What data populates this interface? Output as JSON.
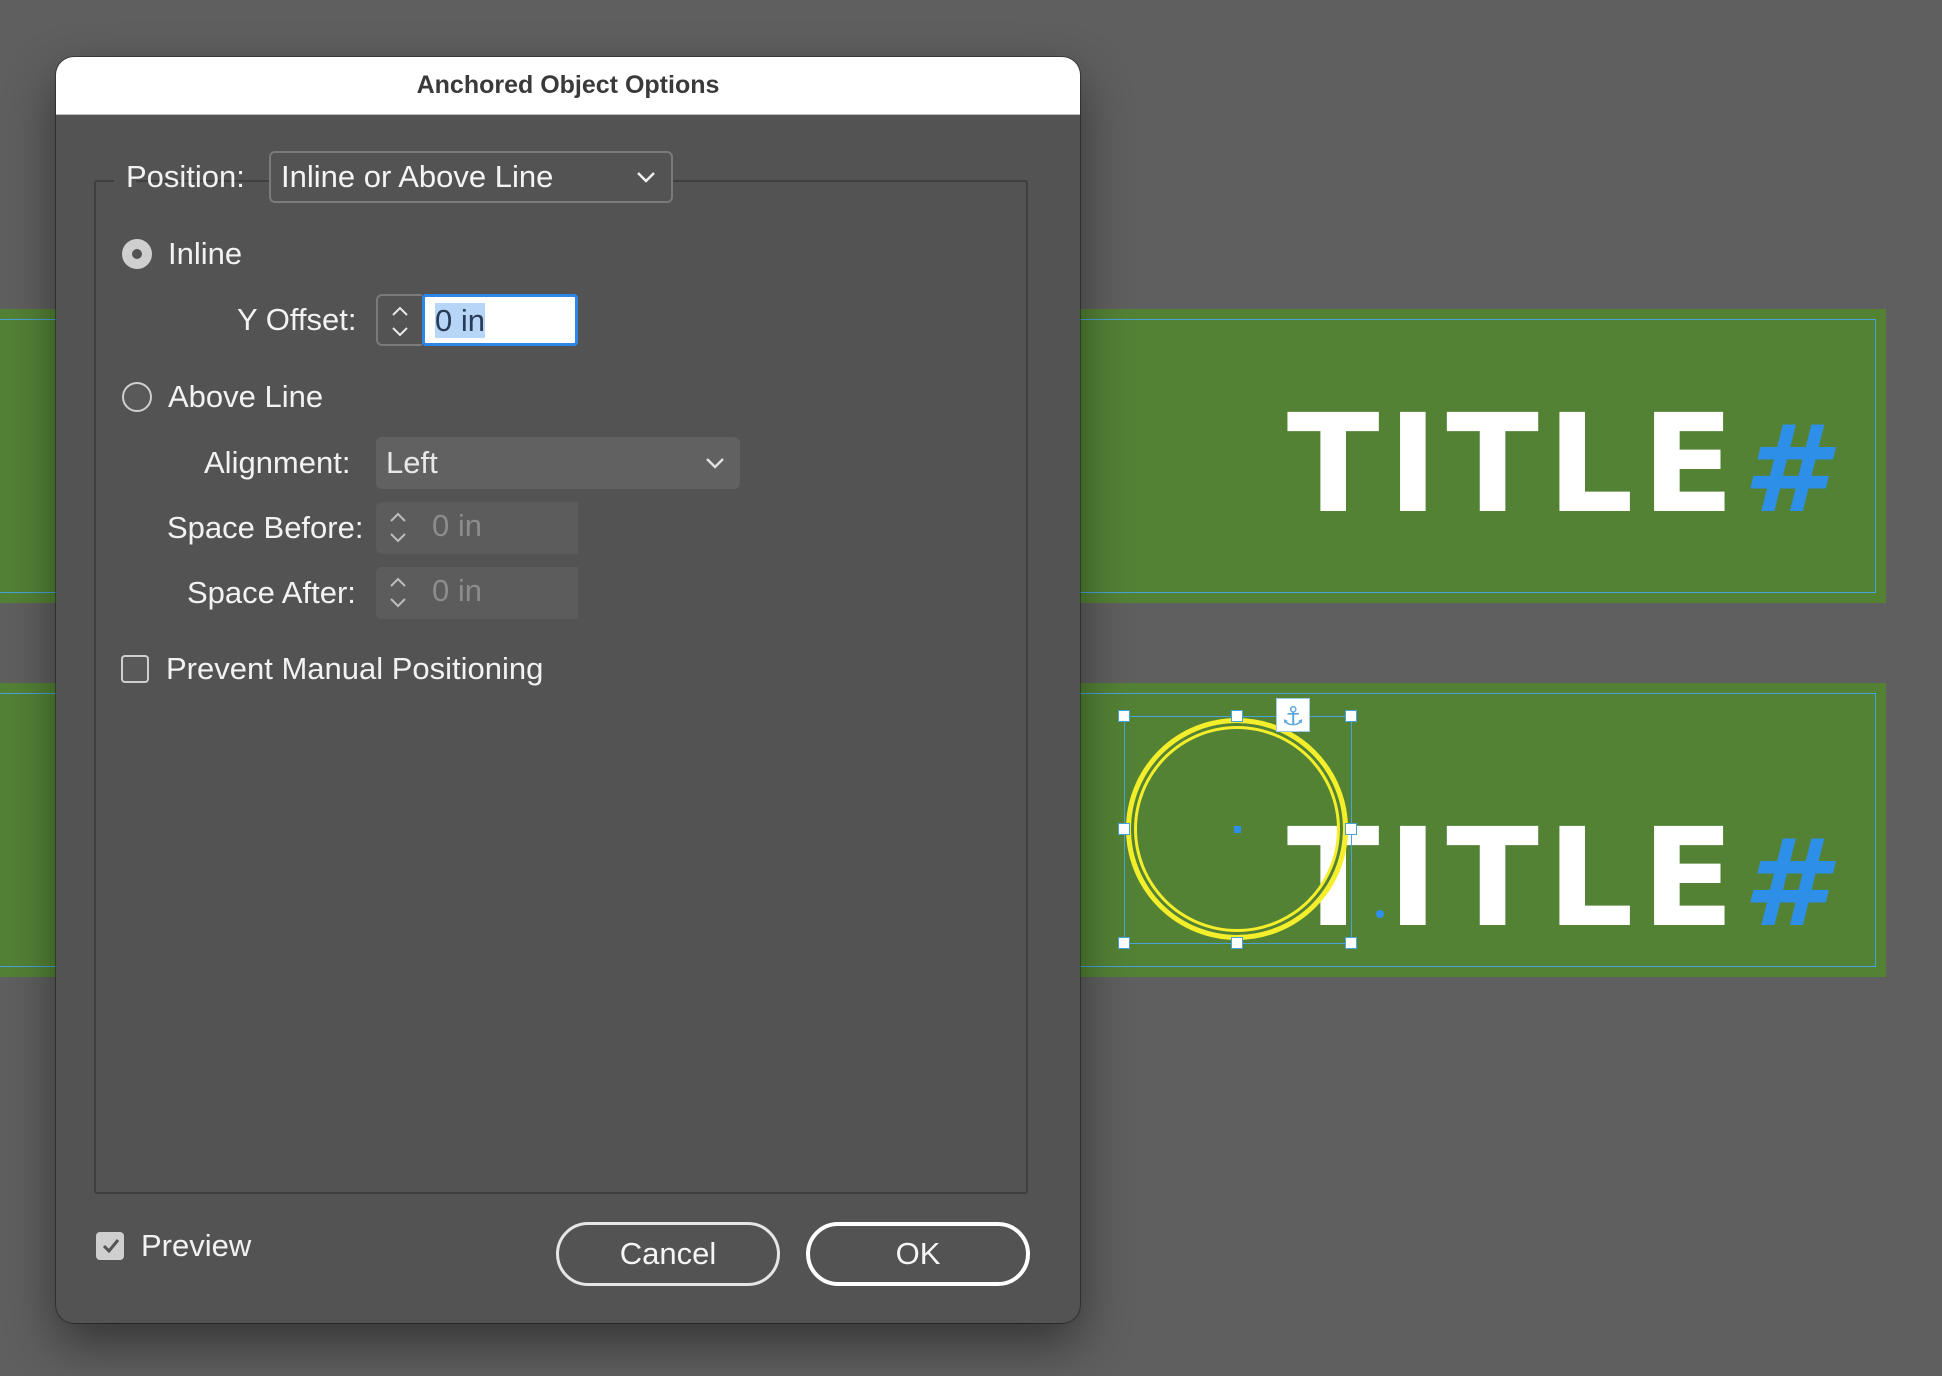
{
  "canvas": {
    "band_title": "TITLE",
    "band_title_suffix": "#",
    "anchor_icon": "anchor-icon"
  },
  "dialog": {
    "title": "Anchored Object Options",
    "position": {
      "label": "Position:",
      "selected": "Inline or Above Line"
    },
    "inline": {
      "label": "Inline",
      "checked": true,
      "y_offset": {
        "label": "Y Offset:",
        "value": "0 in"
      }
    },
    "above_line": {
      "label": "Above Line",
      "checked": false,
      "alignment": {
        "label": "Alignment:",
        "selected": "Left"
      },
      "space_before": {
        "label": "Space Before:",
        "value": "0 in"
      },
      "space_after": {
        "label": "Space After:",
        "value": "0 in"
      }
    },
    "prevent_manual_positioning": {
      "label": "Prevent Manual Positioning",
      "checked": false
    },
    "preview": {
      "label": "Preview",
      "checked": true
    },
    "buttons": {
      "cancel": "Cancel",
      "ok": "OK"
    }
  },
  "colors": {
    "canvas_bg": "#5f5f5f",
    "band_green": "#538235",
    "guide_blue": "#49a3d8",
    "selection_yellow": "#f4ef2a",
    "dialog_bg": "#535353",
    "focus_blue": "#2d87e6"
  }
}
